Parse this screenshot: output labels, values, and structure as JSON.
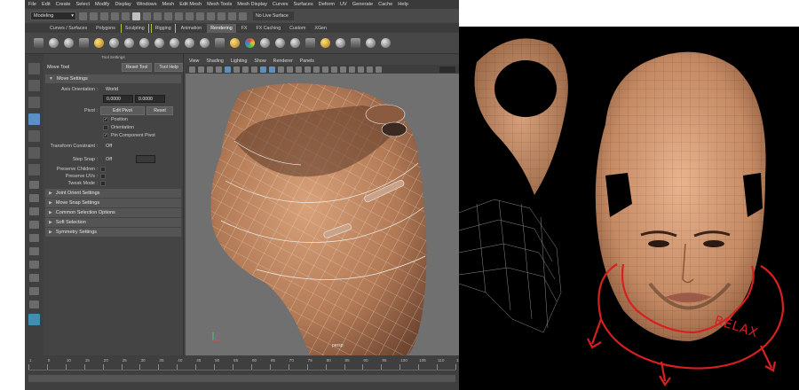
{
  "menubar": [
    "File",
    "Edit",
    "Create",
    "Select",
    "Modify",
    "Display",
    "Windows",
    "Mesh",
    "Edit Mesh",
    "Mesh Tools",
    "Mesh Display",
    "Curves",
    "Surfaces",
    "Deform",
    "UV",
    "Generate",
    "Cache",
    "Help"
  ],
  "statusline": {
    "mode": "Modeling",
    "live_surface": "No Live Surface"
  },
  "shelf_tabs": [
    {
      "label": "Curves / Surfaces",
      "state": ""
    },
    {
      "label": "Polygons",
      "state": ""
    },
    {
      "label": "Sculpting",
      "state": "bracket"
    },
    {
      "label": "Rigging",
      "state": "bracket"
    },
    {
      "label": "Animation",
      "state": ""
    },
    {
      "label": "Rendering",
      "state": "active"
    },
    {
      "label": "FX",
      "state": ""
    },
    {
      "label": "FX Caching",
      "state": ""
    },
    {
      "label": "Custom",
      "state": ""
    },
    {
      "label": "XGen",
      "state": ""
    }
  ],
  "tool_settings": {
    "title": "Tool Settings",
    "tool_name": "Move Tool",
    "reset_button": "Reset Tool",
    "help_button": "Tool Help",
    "section_move": "Move Settings",
    "axis_orientation_label": "Axis Orientation :",
    "axis_orientation_value": "World",
    "value_a": "0.0000",
    "value_b": "0.0000",
    "pivot_label": "Pivot :",
    "edit_pivot": "Edit Pivot",
    "reset": "Reset",
    "chk_position": "Position",
    "chk_orientation": "Orientation",
    "chk_pin": "Pin Component Pivot",
    "transform_constraint_label": "Transform Constraint :",
    "transform_constraint_value": "Off",
    "step_snap_label": "Step Snap :",
    "step_snap_value": "Off",
    "preserve_children": "Preserve Children :",
    "preserve_uvs": "Preserve UVs :",
    "tweak_mode": "Tweak Mode :",
    "sections": [
      "Joint Orient Settings",
      "Move Snap Settings",
      "Common Selection Options",
      "Soft Selection",
      "Symmetry Settings"
    ]
  },
  "viewport": {
    "menu": [
      "View",
      "Shading",
      "Lighting",
      "Show",
      "Renderer",
      "Panels"
    ],
    "camera": "persp"
  },
  "timeline": {
    "ticks": [
      "1",
      "5",
      "10",
      "15",
      "20",
      "25",
      "30",
      "35",
      "40",
      "45",
      "50",
      "55",
      "60",
      "65",
      "70",
      "75",
      "80",
      "85",
      "90",
      "95",
      "100",
      "105",
      "110",
      "115"
    ]
  },
  "annotation": {
    "text": "RELAX",
    "color": "#d62020"
  },
  "colors": {
    "ui_bg": "#444444",
    "selection_blue": "#5c8fc4",
    "shelf_green": "#9bd13b",
    "skin": "#c9926a"
  }
}
